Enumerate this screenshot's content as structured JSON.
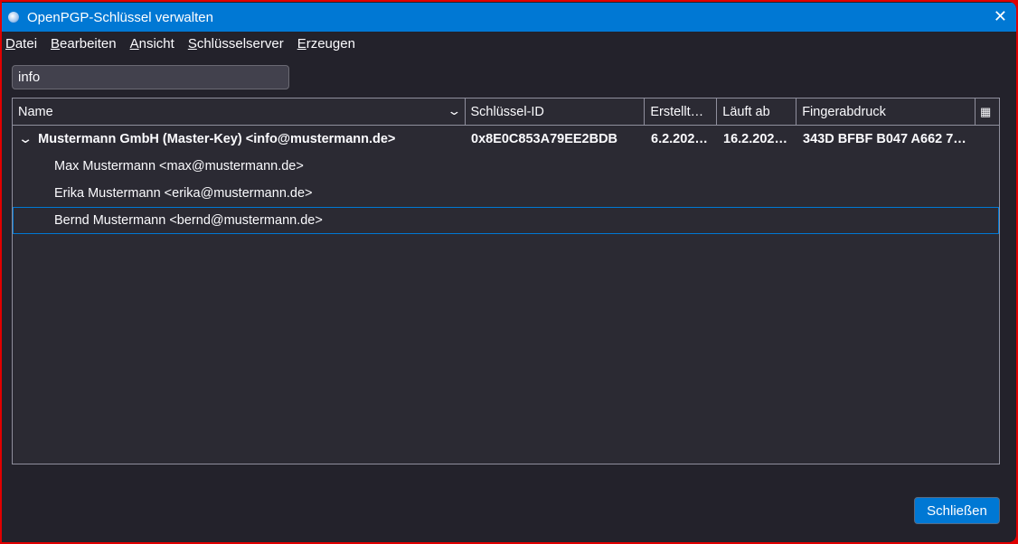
{
  "window": {
    "title": "OpenPGP-Schlüssel verwalten"
  },
  "menu": [
    "Datei",
    "Bearbeiten",
    "Ansicht",
    "Schlüsselserver",
    "Erzeugen"
  ],
  "search": {
    "value": "info"
  },
  "columns": [
    "Name",
    "Schlüssel-ID",
    "Erstellt…",
    "Läuft ab",
    "Fingerabdruck"
  ],
  "rows": [
    {
      "name": "Mustermann GmbH (Master-Key) <info@mustermann.de>",
      "id": "0x8E0C853A79EE2BDB",
      "created": "6.2.202…",
      "expires": "16.2.202…",
      "fingerprint": "343D BFBF B047 A662 7…"
    },
    {
      "name": "Max Mustermann <max@mustermann.de>"
    },
    {
      "name": "Erika Mustermann <erika@mustermann.de>"
    },
    {
      "name": "Bernd Mustermann <bernd@mustermann.de>"
    }
  ],
  "footer": {
    "close_label": "Schließen"
  }
}
